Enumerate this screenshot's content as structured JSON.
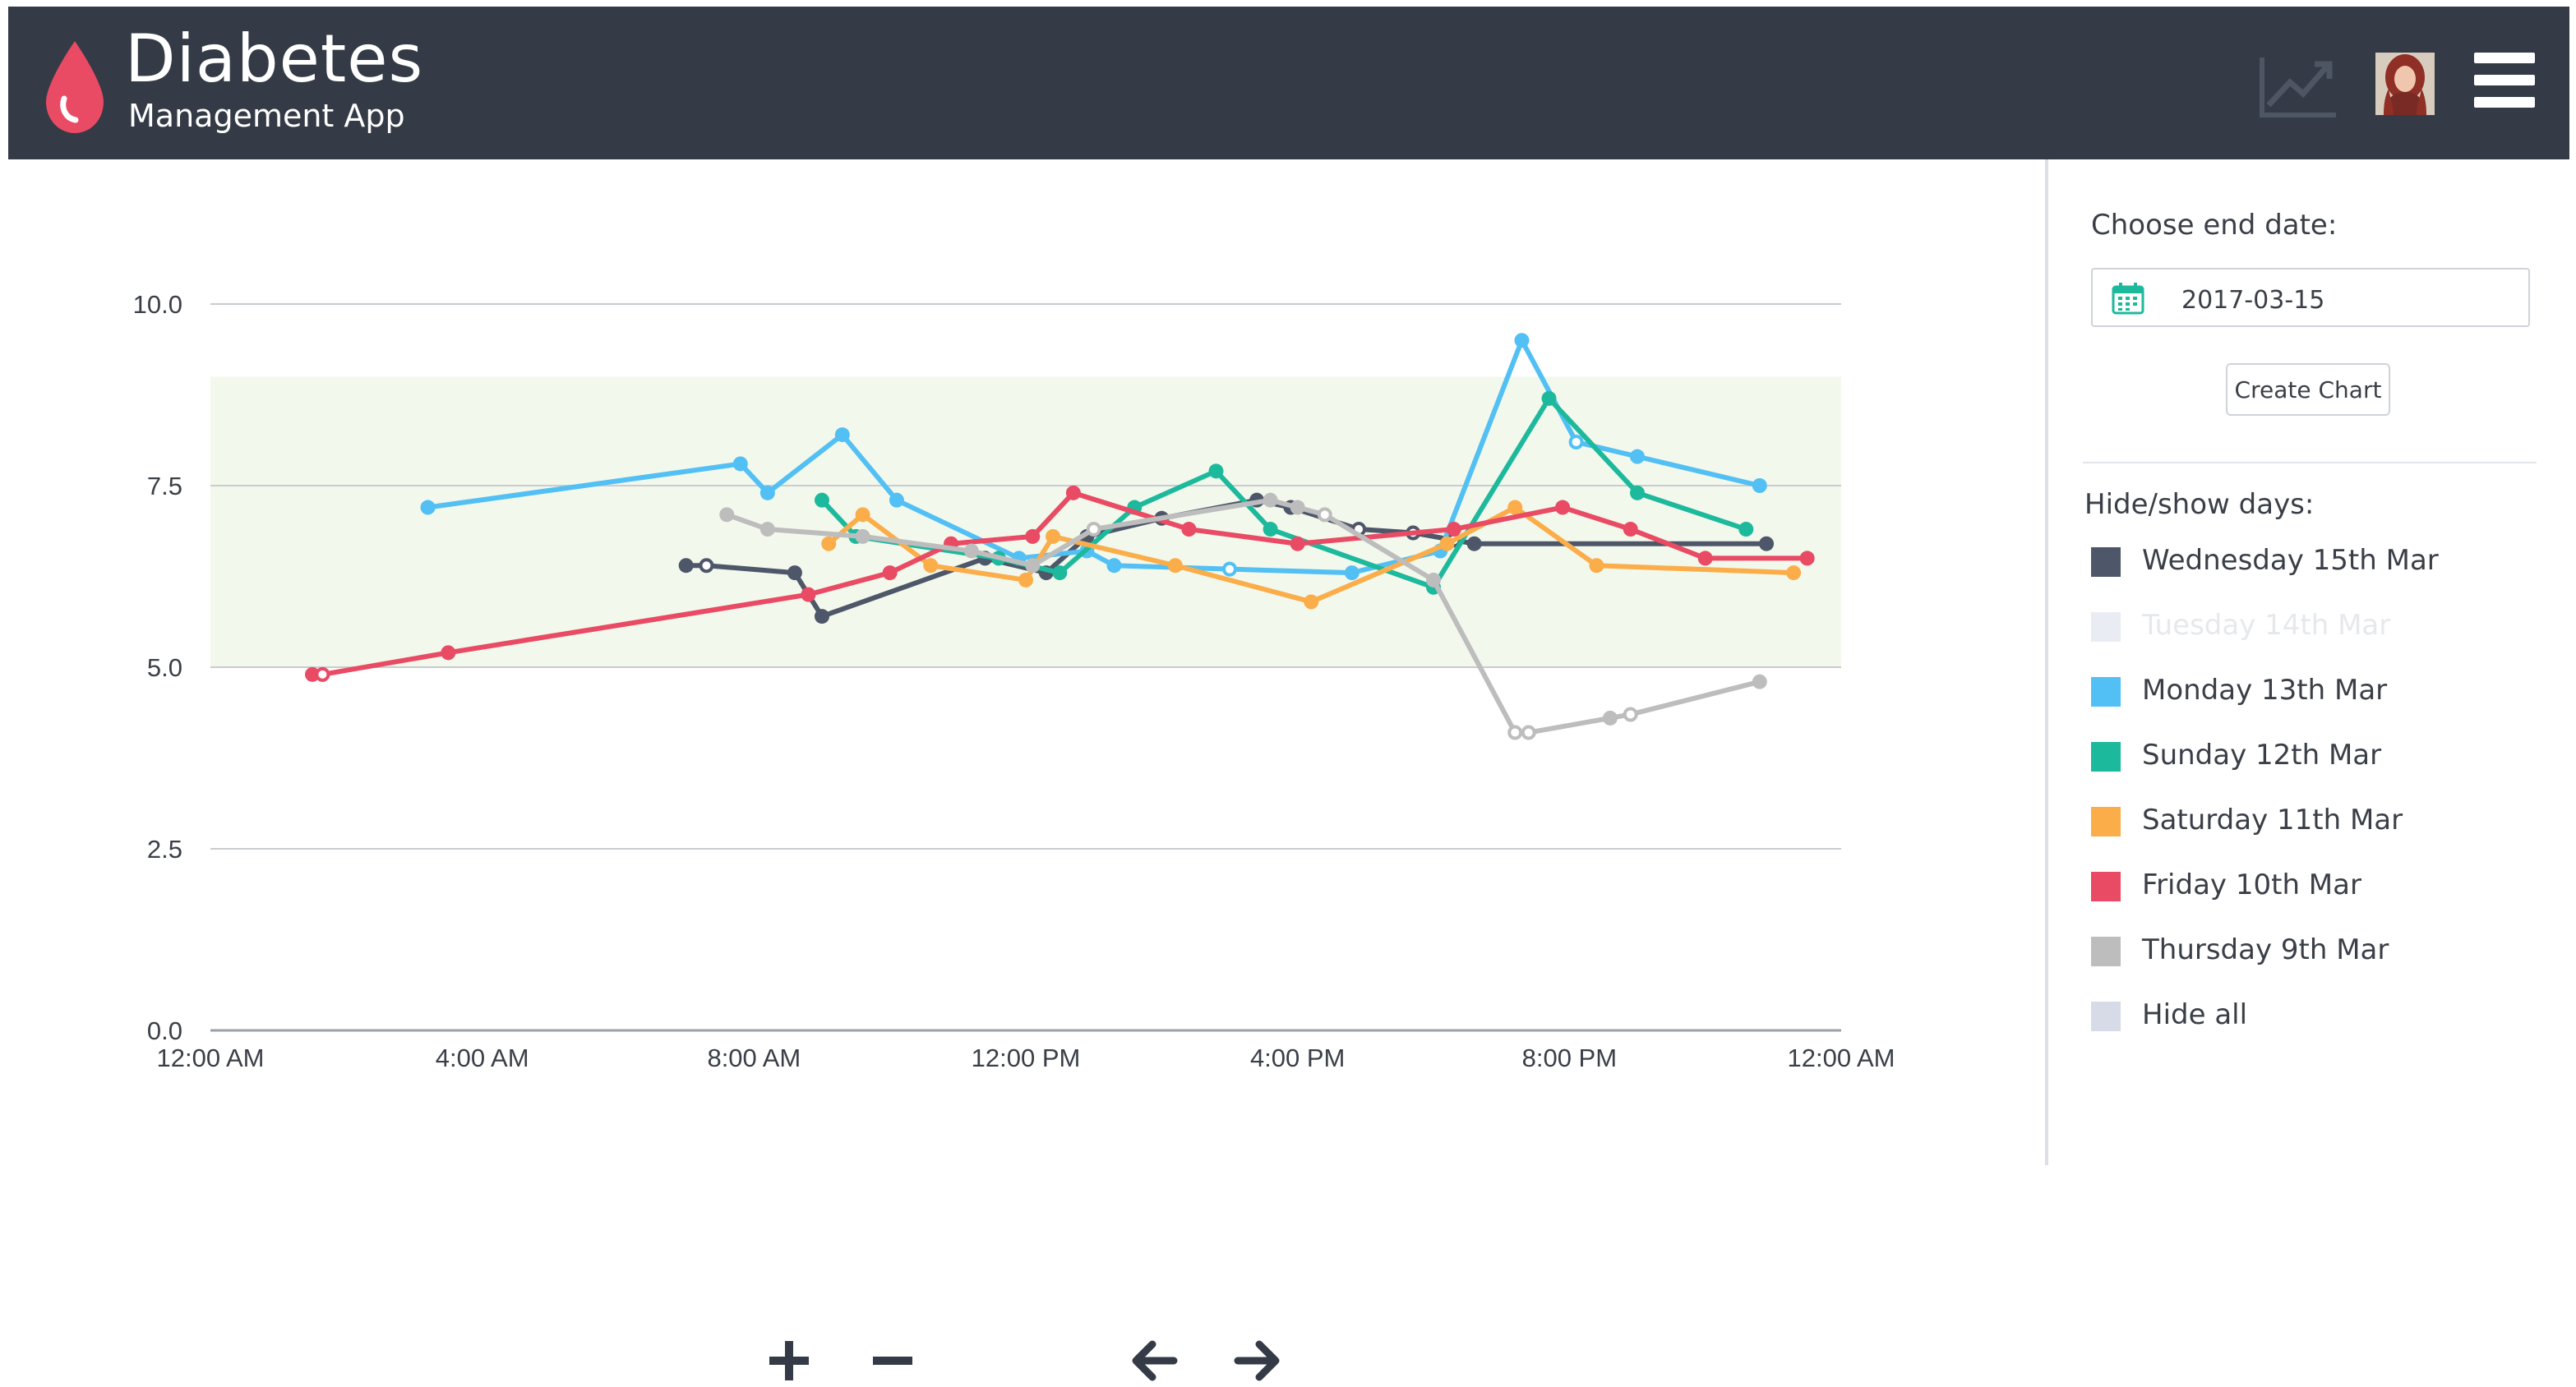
{
  "header": {
    "title": "Diabetes",
    "subtitle": "Management App",
    "brand_color": "#e94a64",
    "background": "#343b46",
    "icons": [
      "blood-drop-icon",
      "trend-chart-icon",
      "user-avatar",
      "hamburger-menu-icon"
    ]
  },
  "sidebar": {
    "end_date_label": "Choose end date:",
    "end_date_value": "2017-03-15",
    "create_button": "Create Chart",
    "toggle_label": "Hide/show days:",
    "days": [
      {
        "label": "Wednesday 15th Mar",
        "color": "#4d5769",
        "visible": true
      },
      {
        "label": "Tuesday 14th Mar",
        "color": "#e9ecf2",
        "visible": false
      },
      {
        "label": "Monday 13th Mar",
        "color": "#52c0f4",
        "visible": true
      },
      {
        "label": "Sunday 12th Mar",
        "color": "#1db99c",
        "visible": true
      },
      {
        "label": "Saturday 11th Mar",
        "color": "#fbad4a",
        "visible": true
      },
      {
        "label": "Friday 10th Mar",
        "color": "#e94a64",
        "visible": true
      },
      {
        "label": "Thursday 9th Mar",
        "color": "#bdbdbd",
        "visible": true
      },
      {
        "label": "Hide all",
        "color": "#d7dbe8",
        "visible": true
      }
    ]
  },
  "controls": {
    "zoom_in_icon": "plus-icon",
    "zoom_out_icon": "minus-icon",
    "back_icon": "arrow-left-icon",
    "forward_icon": "arrow-right-icon"
  },
  "chart_data": {
    "type": "line",
    "x_unit": "hours since 12:00 AM",
    "xlim": [
      0,
      24
    ],
    "ylim": [
      0,
      10
    ],
    "x_ticks": [
      "12:00 AM",
      "4:00 AM",
      "8:00 AM",
      "12:00 PM",
      "4:00 PM",
      "8:00 PM",
      "12:00 AM"
    ],
    "y_ticks": [
      "0.0",
      "2.5",
      "5.0",
      "7.5",
      "10.0"
    ],
    "target_band": [
      5,
      9
    ],
    "band_color": "#f3f8ec",
    "grid": true,
    "legend": "sidebar",
    "series": [
      {
        "name": "Wednesday 15th Mar",
        "color": "#4d5769",
        "points": [
          [
            7.0,
            6.4
          ],
          [
            7.3,
            6.4
          ],
          [
            8.6,
            6.3
          ],
          [
            9.0,
            5.7
          ],
          [
            11.4,
            6.5
          ],
          [
            12.3,
            6.3
          ],
          [
            12.9,
            6.8
          ],
          [
            14.0,
            7.05
          ],
          [
            15.4,
            7.3
          ],
          [
            15.9,
            7.2
          ],
          [
            16.9,
            6.9
          ],
          [
            17.7,
            6.85
          ],
          [
            18.3,
            6.75
          ],
          [
            18.6,
            6.7
          ],
          [
            22.9,
            6.7
          ]
        ],
        "hollow": [
          1,
          10,
          11,
          12
        ]
      },
      {
        "name": "Monday 13th Mar",
        "color": "#52c0f4",
        "points": [
          [
            3.2,
            7.2
          ],
          [
            7.8,
            7.8
          ],
          [
            8.2,
            7.4
          ],
          [
            9.3,
            8.2
          ],
          [
            10.1,
            7.3
          ],
          [
            11.9,
            6.5
          ],
          [
            12.9,
            6.6
          ],
          [
            13.3,
            6.4
          ],
          [
            15.0,
            6.35
          ],
          [
            16.8,
            6.3
          ],
          [
            18.1,
            6.6
          ],
          [
            19.3,
            9.5
          ],
          [
            20.1,
            8.1
          ],
          [
            21.0,
            7.9
          ],
          [
            22.8,
            7.5
          ]
        ],
        "hollow": [
          8,
          12
        ]
      },
      {
        "name": "Sunday 12th Mar",
        "color": "#1db99c",
        "points": [
          [
            9.0,
            7.3
          ],
          [
            9.5,
            6.8
          ],
          [
            11.6,
            6.5
          ],
          [
            12.5,
            6.3
          ],
          [
            13.6,
            7.2
          ],
          [
            14.8,
            7.7
          ],
          [
            15.6,
            6.9
          ],
          [
            18.0,
            6.1
          ],
          [
            19.7,
            8.7
          ],
          [
            21.0,
            7.4
          ],
          [
            22.6,
            6.9
          ]
        ],
        "hollow": []
      },
      {
        "name": "Saturday 11th Mar",
        "color": "#fbad4a",
        "points": [
          [
            9.1,
            6.7
          ],
          [
            9.6,
            7.1
          ],
          [
            10.6,
            6.4
          ],
          [
            12.0,
            6.2
          ],
          [
            12.4,
            6.8
          ],
          [
            14.2,
            6.4
          ],
          [
            16.2,
            5.9
          ],
          [
            18.2,
            6.7
          ],
          [
            19.2,
            7.2
          ],
          [
            20.4,
            6.4
          ],
          [
            23.3,
            6.3
          ]
        ],
        "hollow": []
      },
      {
        "name": "Friday 10th Mar",
        "color": "#e94a64",
        "points": [
          [
            1.5,
            4.9
          ],
          [
            1.65,
            4.9
          ],
          [
            3.5,
            5.2
          ],
          [
            8.8,
            6.0
          ],
          [
            10.0,
            6.3
          ],
          [
            10.9,
            6.7
          ],
          [
            12.1,
            6.8
          ],
          [
            12.7,
            7.4
          ],
          [
            14.4,
            6.9
          ],
          [
            16.0,
            6.7
          ],
          [
            18.3,
            6.9
          ],
          [
            19.9,
            7.2
          ],
          [
            20.9,
            6.9
          ],
          [
            22.0,
            6.5
          ],
          [
            23.5,
            6.5
          ]
        ],
        "hollow": [
          1
        ]
      },
      {
        "name": "Thursday 9th Mar",
        "color": "#bdbdbd",
        "points": [
          [
            7.6,
            7.1
          ],
          [
            8.2,
            6.9
          ],
          [
            9.6,
            6.8
          ],
          [
            11.2,
            6.6
          ],
          [
            12.1,
            6.4
          ],
          [
            13.0,
            6.9
          ],
          [
            15.6,
            7.3
          ],
          [
            16.0,
            7.2
          ],
          [
            16.4,
            7.1
          ],
          [
            18.0,
            6.2
          ],
          [
            19.2,
            4.1
          ],
          [
            19.4,
            4.1
          ],
          [
            20.6,
            4.3
          ],
          [
            20.9,
            4.35
          ],
          [
            22.8,
            4.8
          ]
        ],
        "hollow": [
          5,
          8,
          10,
          11,
          13
        ]
      }
    ]
  }
}
